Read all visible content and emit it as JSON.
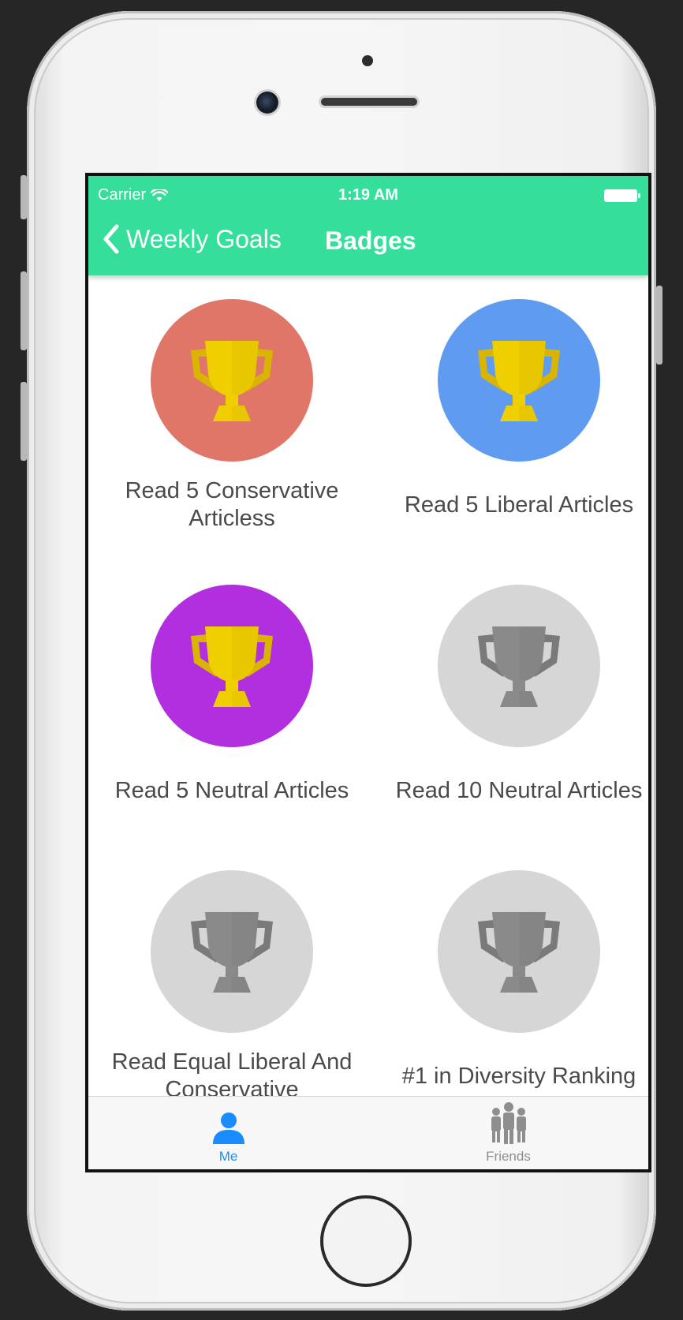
{
  "status_bar": {
    "carrier": "Carrier",
    "time": "1:19 AM"
  },
  "nav": {
    "back_label": "Weekly Goals",
    "title": "Badges"
  },
  "badges": [
    {
      "label": "Read 5 Conservative Articless",
      "color": "#e07668",
      "earned": true
    },
    {
      "label": "Read 5 Liberal Articles",
      "color": "#5f9bf0",
      "earned": true
    },
    {
      "label": "Read 5 Neutral Articles",
      "color": "#b22fe0",
      "earned": true
    },
    {
      "label": "Read 10 Neutral Articles",
      "color": "#d6d6d6",
      "earned": false
    },
    {
      "label": "Read Equal Liberal And Conservative",
      "color": "#d6d6d6",
      "earned": false
    },
    {
      "label": "#1 in Diversity Ranking",
      "color": "#d6d6d6",
      "earned": false
    }
  ],
  "tabs": [
    {
      "label": "Me",
      "icon": "person-icon",
      "active": true
    },
    {
      "label": "Friends",
      "icon": "group-icon",
      "active": false
    }
  ],
  "colors": {
    "accent": "#35de9b",
    "tab_active": "#1a8cff",
    "tab_inactive": "#8e8e8e",
    "trophy_gold": "#f0cf00",
    "trophy_gray": "#8a8a8a"
  }
}
